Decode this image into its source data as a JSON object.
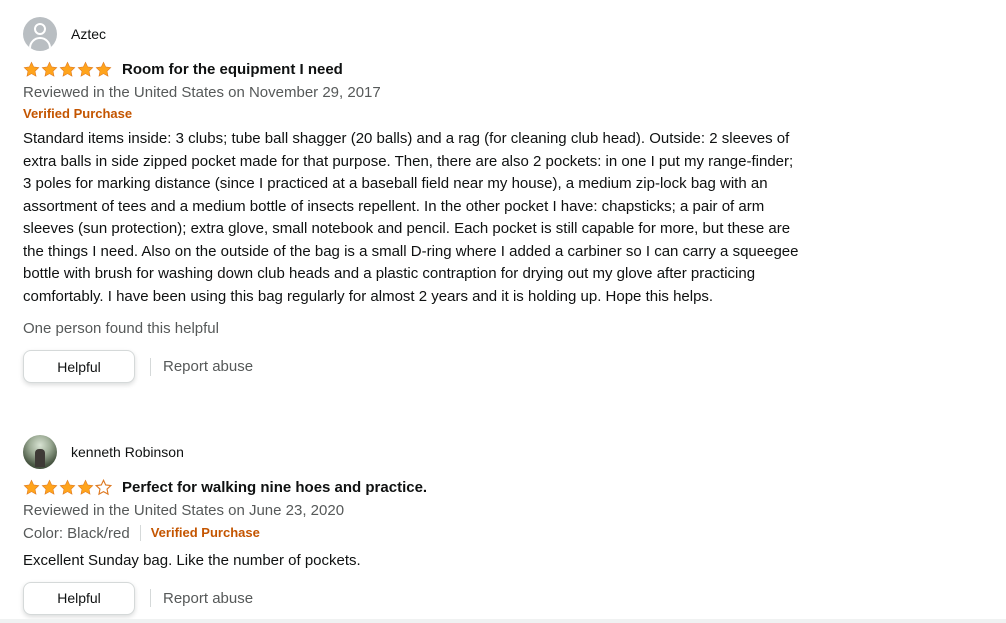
{
  "colors": {
    "star": "#ffa41c",
    "verified": "#c45500",
    "muted": "#565959"
  },
  "reviews": [
    {
      "reviewer": "Aztec",
      "avatar": "default-profile-icon",
      "rating": 5,
      "title": "Room for the equipment I need",
      "date_line": "Reviewed in the United States on November 29, 2017",
      "verified": "Verified Purchase",
      "body": "Standard items inside: 3 clubs; tube ball shagger (20 balls) and a rag (for cleaning club head). Outside: 2 sleeves of extra balls in side zipped pocket made for that purpose. Then, there are also 2 pockets: in one I put my range-finder; 3 poles for marking distance (since I practiced at a baseball field near my house), a medium zip-lock bag with an assortment of tees and a medium bottle of insects repellent. In the other pocket I have: chapsticks; a pair of arm sleeves (sun protection); extra glove, small notebook and pencil. Each pocket is still capable for more, but these are the things I need. Also on the outside of the bag is a small D-ring where I added a carbiner so I can carry a squeegee bottle with brush for washing down club heads and a plastic contraption for drying out my glove after practicing comfortably. I have been using this bag regularly for almost 2 years and it is holding up. Hope this helps.",
      "helpful_count": "One person found this helpful",
      "helpful_label": "Helpful",
      "report_label": "Report abuse"
    },
    {
      "reviewer": "kenneth Robinson",
      "avatar": "profile-photo",
      "rating": 4,
      "title": "Perfect for walking nine hoes and practice.",
      "date_line": "Reviewed in the United States on June 23, 2020",
      "format": "Color: Black/red",
      "verified": "Verified Purchase",
      "body": "Excellent Sunday bag. Like the number of pockets.",
      "helpful_label": "Helpful",
      "report_label": "Report abuse"
    }
  ]
}
